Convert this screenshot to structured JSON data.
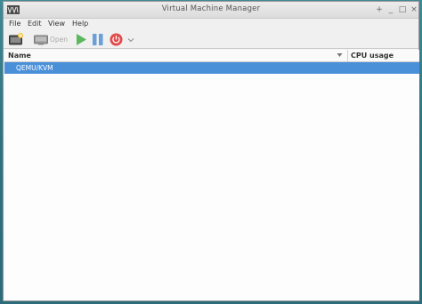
{
  "window": {
    "title": "Virtual Machine Manager"
  },
  "window_controls": {
    "new": "+",
    "minimize": "_",
    "maximize": "□",
    "close": "×"
  },
  "menu": [
    {
      "label": "File"
    },
    {
      "label": "Edit"
    },
    {
      "label": "View"
    },
    {
      "label": "Help"
    }
  ],
  "toolbar": {
    "open_label": "Open"
  },
  "list": {
    "columns": {
      "name": "Name",
      "cpu": "CPU usage"
    },
    "rows": [
      {
        "label": "QEMU/KVM",
        "selected": true
      }
    ]
  },
  "colors": {
    "selection": "#4a90d9",
    "run": "#5cb85c",
    "pause": "#6a9fd8",
    "power": "#e04a4a"
  },
  "icons": [
    "app-logo-icon",
    "new-vm-icon",
    "monitor-icon",
    "run-icon",
    "pause-icon",
    "power-icon",
    "chevron-down-icon",
    "sort-down-icon"
  ]
}
